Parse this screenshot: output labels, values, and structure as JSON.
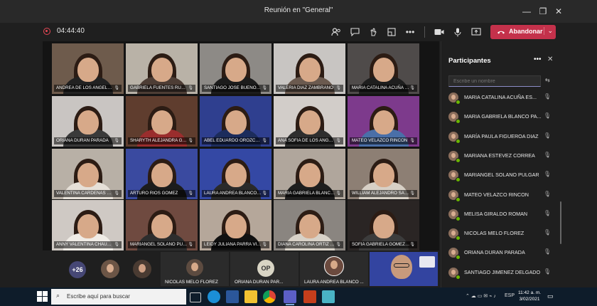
{
  "window": {
    "title": "Reunión en \"General\""
  },
  "toolbar": {
    "timer": "04:44:40",
    "leave_label": "Abandonar",
    "leave_color": "#c4314b"
  },
  "grid": {
    "tiles": [
      {
        "name": "ANDREA DE LOS ANGELES S...",
        "bg": "#6e5b4c",
        "shirt": "#222"
      },
      {
        "name": "GABRIELA FUENTES RUEDA",
        "bg": "#b9b2a7",
        "shirt": "#4d3d35"
      },
      {
        "name": "SANTIAGO JOSE BUENO GUT...",
        "bg": "#8d8a86",
        "shirt": "#1c1c1c"
      },
      {
        "name": "VALERIA DIAZ ZAMBRANO",
        "bg": "#c8c5c2",
        "shirt": "#6b5a4f"
      },
      {
        "name": "MARIA CATALINA ACUÑA ES...",
        "bg": "#4f4b4a",
        "shirt": "#1e1e1e"
      },
      {
        "name": "ORIANA DURAN PARADA",
        "bg": "#c9c5c2",
        "shirt": "#3a3a3a"
      },
      {
        "name": "SHARYTH ALEJANDRA GALE...",
        "bg": "#5f3d2e",
        "shirt": "#9a2d2d"
      },
      {
        "name": "ABEL EDUARDO OROZCO P...",
        "bg": "#2f3f8f",
        "shirt": "#1c2c5c"
      },
      {
        "name": "ANA SOFIA DE LOS ANGELES...",
        "bg": "#d2cdc9",
        "shirt": "#2e2e2e"
      },
      {
        "name": "MATEO VELAZCO RINCON",
        "bg": "#7d3a8c",
        "shirt": "#4a6fa8"
      },
      {
        "name": "VALENTINA CARDENAS GEL...",
        "bg": "#b8b0a6",
        "shirt": "#e6e0d8"
      },
      {
        "name": "ARTURO RIOS GOMEZ",
        "bg": "#3a4aa0",
        "shirt": "#1c1c1c"
      },
      {
        "name": "LAURA ANDREA BLANCO GOM...",
        "bg": "#3448a4",
        "shirt": "#2a2a2a"
      },
      {
        "name": "MARIA GABRIELA BLANCO P...",
        "bg": "#b0a69c",
        "shirt": "#1e1e1e"
      },
      {
        "name": "WILLIAM ALEJANDRO SALDA...",
        "bg": "#8d7f74",
        "shirt": "#d7d0c6"
      },
      {
        "name": "ANNY VALENTINA CHAUSTR...",
        "bg": "#cfc9c4",
        "shirt": "#f0ece6"
      },
      {
        "name": "MARIANGEL SOLANO PULG...",
        "bg": "#6f4a40",
        "shirt": "#2d2d2d"
      },
      {
        "name": "LEIDY JULIANA PARRA VILLA...",
        "bg": "#b5a79a",
        "shirt": "#111"
      },
      {
        "name": "DIANA CAROLINA ORTIZ EST...",
        "bg": "#8a8580",
        "shirt": "#d8d2c8"
      },
      {
        "name": "SOFIA GABRIELA GOMEZ CA...",
        "bg": "#2a2524",
        "shirt": "#3c3c3c"
      }
    ]
  },
  "strip": {
    "overflow_count": "+26",
    "tiles": [
      {
        "name": "NICOLAS MELO FLOREZ"
      },
      {
        "name": "ORIANA DURAN PAR..."
      },
      {
        "name": "LAURA ANDREA BLANCO ..."
      }
    ],
    "op_initials": "OP"
  },
  "panel": {
    "title": "Participantes",
    "search_placeholder": "Escribe un nombre",
    "participants": [
      "MARIA CATALINA ACUÑA ES...",
      "MARIA GABRIELA BLANCO PA...",
      "MARÍA PAULA FIGUEROA DIAZ",
      "MARIANA ESTEVEZ CORREA",
      "MARIANGEL SOLANO PULGAR",
      "MATEO VELAZCO RINCON",
      "MELISA GIRALDO ROMAN",
      "NICOLAS MELO FLOREZ",
      "ORIANA DURAN PARADA",
      "SANTIAGO JIMENEZ DELGADO"
    ]
  },
  "taskbar": {
    "search_placeholder": "Escribe aquí para buscar",
    "lang": "ESP",
    "time": "11:42 a. m.",
    "date": "3/02/2021"
  }
}
